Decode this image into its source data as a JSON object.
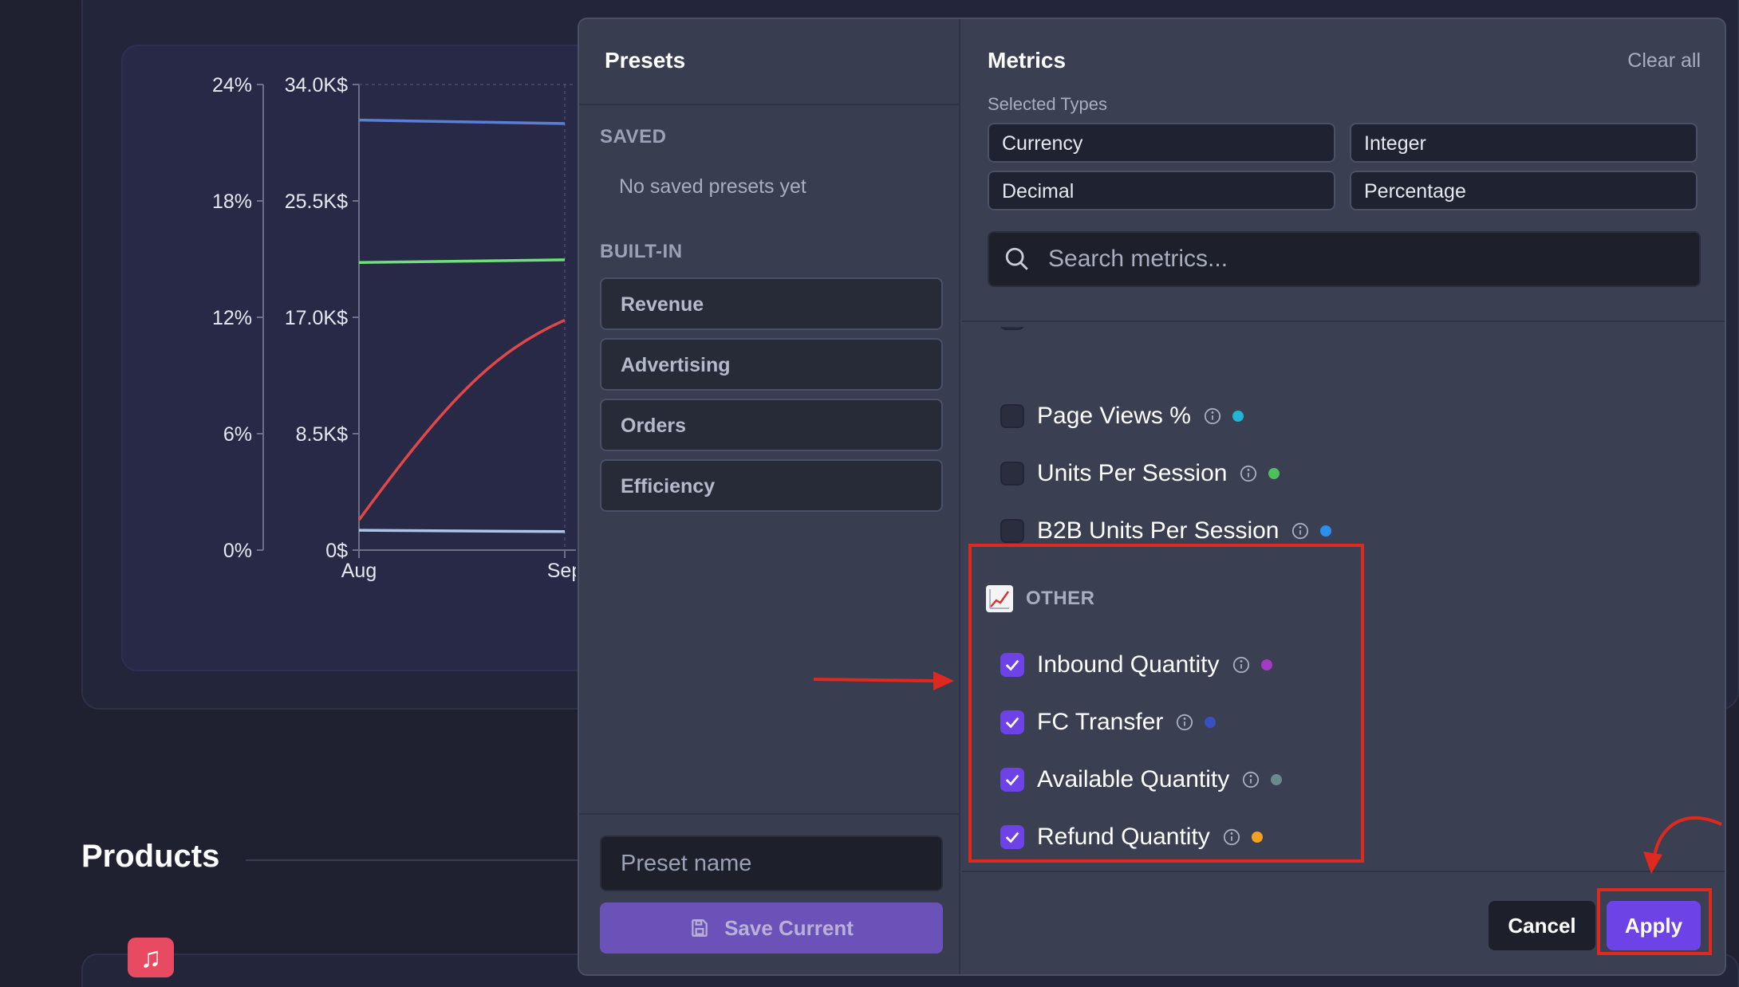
{
  "background": {
    "section_title": "Products"
  },
  "chart_data": {
    "type": "line",
    "x_ticks": [
      "Aug",
      "Sep"
    ],
    "left_axis_ticks": [
      "24%",
      "18%",
      "12%",
      "6%",
      "0%"
    ],
    "right_axis_ticks": [
      "34.0K$",
      "25.5K$",
      "17.0K$",
      "8.5K$",
      "0$"
    ],
    "ylim_percent": [
      0,
      24
    ],
    "ylim_currency": [
      0,
      34000
    ],
    "series": [
      {
        "color": "#5b7fd6",
        "axis": "currency",
        "values": [
          31400,
          31150
        ]
      },
      {
        "color": "#6ee07a",
        "axis": "currency",
        "values": [
          21000,
          21200
        ]
      },
      {
        "color": "#e04848",
        "axis": "currency",
        "values": [
          2200,
          16800
        ]
      },
      {
        "color": "#a9c6e8",
        "axis": "currency",
        "values": [
          1450,
          1350
        ]
      }
    ]
  },
  "presets": {
    "title": "Presets",
    "saved_label": "SAVED",
    "saved_empty": "No saved presets yet",
    "builtin_label": "BUILT-IN",
    "builtin": [
      "Revenue",
      "Advertising",
      "Orders",
      "Efficiency"
    ],
    "name_placeholder": "Preset name",
    "save_label": "Save Current"
  },
  "metrics": {
    "title": "Metrics",
    "clear_all": "Clear all",
    "selected_types_label": "Selected Types",
    "types": [
      "Currency",
      "Integer",
      "Decimal",
      "Percentage"
    ],
    "search_placeholder": "Search metrics...",
    "rows": [
      {
        "label": "Page Views %",
        "checked": false,
        "color": "#1fb4d8"
      },
      {
        "label": "Units Per Session",
        "checked": false,
        "color": "#4cc05a"
      },
      {
        "label": "B2B Units Per Session",
        "checked": false,
        "color": "#2a8ff0"
      }
    ],
    "group": {
      "label": "OTHER",
      "icon": "chart-increasing-icon",
      "rows": [
        {
          "label": "Inbound Quantity",
          "checked": true,
          "color": "#a53ac4"
        },
        {
          "label": "FC Transfer",
          "checked": true,
          "color": "#3a4fc4"
        },
        {
          "label": "Available Quantity",
          "checked": true,
          "color": "#6a8a8c"
        },
        {
          "label": "Refund Quantity",
          "checked": true,
          "color": "#f5a020"
        }
      ]
    },
    "cancel_label": "Cancel",
    "apply_label": "Apply"
  },
  "colors": {
    "accent": "#6d42e6",
    "annotation": "#e0291e"
  }
}
